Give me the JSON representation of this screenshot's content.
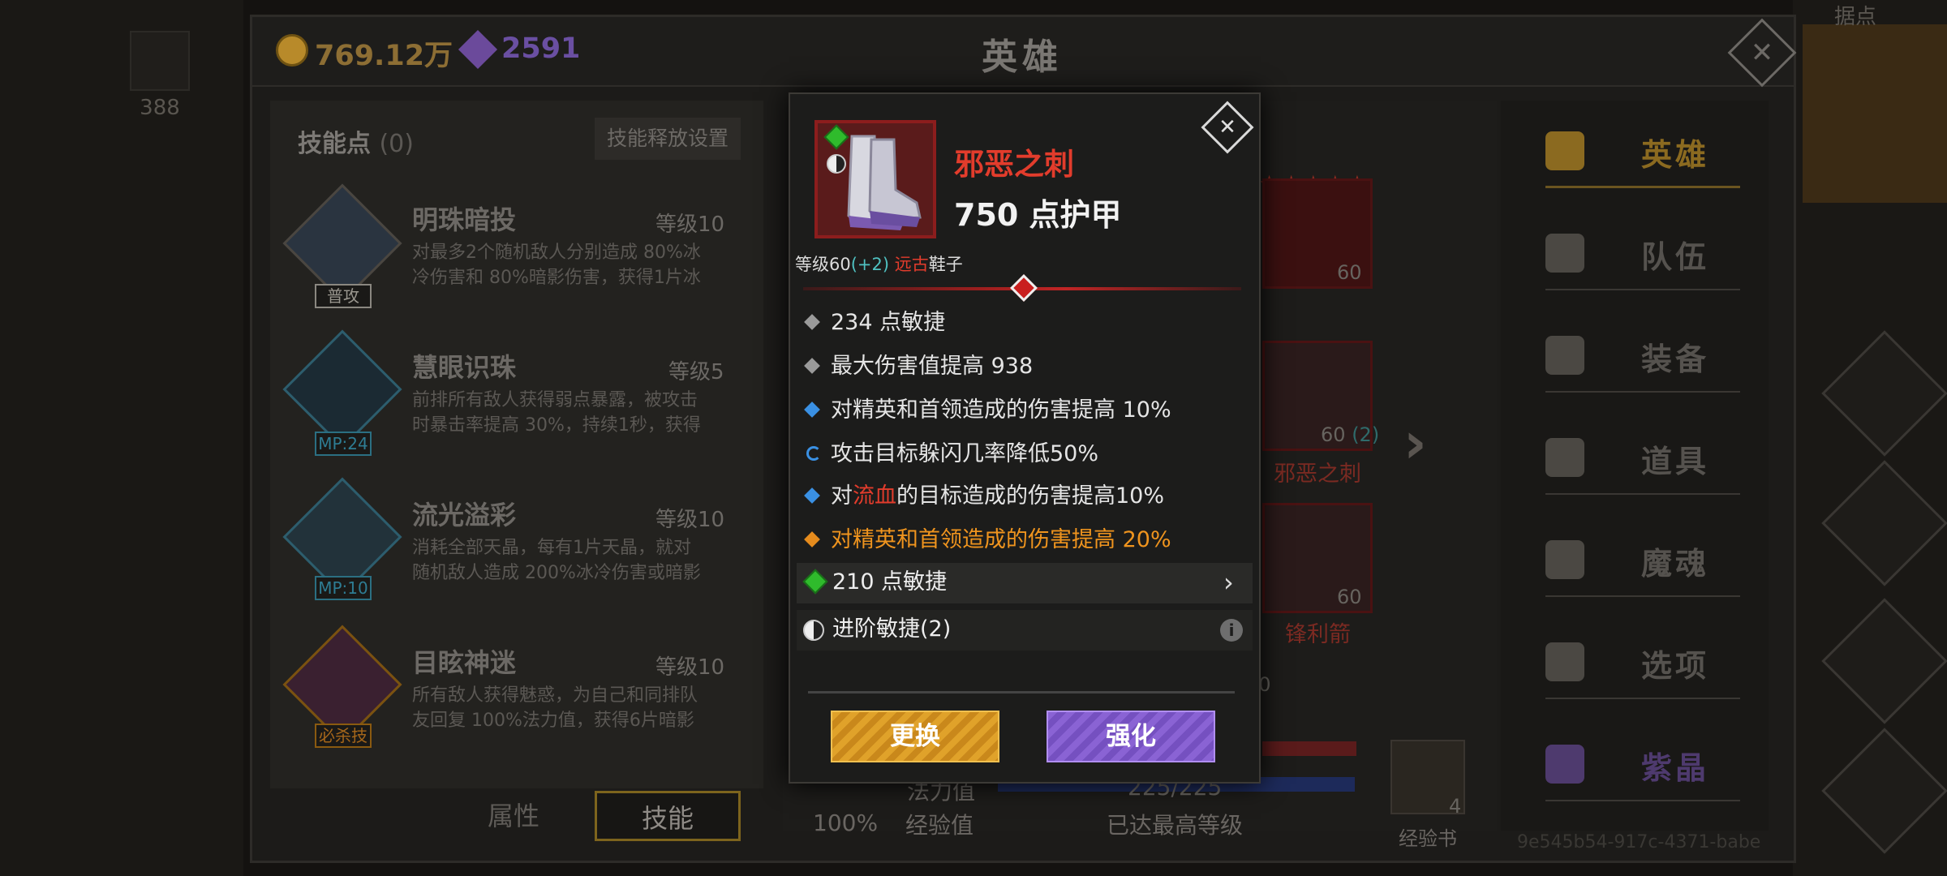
{
  "external": {
    "left_count": "388",
    "right_top_label": "据点"
  },
  "header": {
    "gold": "769.12万",
    "gems": "2591",
    "title": "英雄"
  },
  "skills_panel": {
    "points_label": "技能点",
    "points_value": "(0)",
    "release_settings": "技能释放设置",
    "skills": [
      {
        "name": "明珠暗投",
        "level": "等级10",
        "tag": "普攻",
        "desc1": "对最多2个随机敌人分别造成 80%冰",
        "desc2": "冷伤害和 80%暗影伤害，获得1片冰"
      },
      {
        "name": "慧眼识珠",
        "level": "等级5",
        "tag": "MP:24",
        "desc1": "前排所有敌人获得弱点暴露，被攻击",
        "desc2": "时暴击率提高 30%，持续1秒，获得"
      },
      {
        "name": "流光溢彩",
        "level": "等级10",
        "tag": "MP:10",
        "desc1": "消耗全部天晶，每有1片天晶，就对",
        "desc2": "随机敌人造成 200%冰冷伤害或暗影"
      },
      {
        "name": "目眩神迷",
        "level": "等级10",
        "tag": "必杀技",
        "desc1": "所有敌人获得魅惑，为自己和同排队",
        "desc2": "友回复 100%法力值，获得6片暗影"
      }
    ],
    "tab_attr": "属性",
    "tab_skill": "技能"
  },
  "hero_area": {
    "hero_level": "60",
    "boots_level": "60",
    "boots_plus": "(2)",
    "boots_name": "邪恶之刺",
    "arrow_level": "60",
    "arrow_name": "锋利箭",
    "partial_num": "60",
    "mana_label": "法力值",
    "mana_value": "225/225",
    "exp_label": "经验值",
    "exp_value": "已达最高等级",
    "hp_pct": "100%",
    "book_count": "4",
    "book_label": "经验书"
  },
  "sidebar": {
    "items": [
      {
        "label": "英雄"
      },
      {
        "label": "队伍"
      },
      {
        "label": "装备"
      },
      {
        "label": "道具"
      },
      {
        "label": "魔魂"
      },
      {
        "label": "选项"
      },
      {
        "label": "紫晶"
      }
    ]
  },
  "footer_id": "9e545b54-917c-4371-babe",
  "popup": {
    "item_name": "邪恶之刺",
    "armor": "750 点护甲",
    "meta_level": "等级60",
    "meta_plus": "(+2)",
    "meta_type_red": "远古",
    "meta_type": "鞋子",
    "stats": {
      "s1": "234 点敏捷",
      "s2": "最大伤害值提高 938",
      "s3": "对精英和首领造成的伤害提高 10%",
      "s4": "攻击目标躲闪几率降低50%",
      "s5_pre": "对",
      "s5_hl": "流血",
      "s5_post": "的目标造成的伤害提高10%",
      "s6": "对精英和首领造成的伤害提高 20%"
    },
    "gem_stat": "210 点敏捷",
    "advanced": "进阶敏捷(2)",
    "btn_swap": "更换",
    "btn_upgrade": "强化"
  },
  "colors": {
    "rare_red": "#e23c2c",
    "legend_orange": "#ef941e",
    "gem_green": "#2fbb2c",
    "magic_blue": "#3a90e3"
  },
  "icons": [
    "close-icon",
    "coin-icon",
    "gem-icon",
    "yin-yang-icon",
    "info-icon",
    "chevron-right-icon",
    "hero-icon",
    "flag-icon",
    "helmet-icon",
    "bag-icon",
    "flame-icon",
    "gear-icon",
    "crystal-icon"
  ]
}
